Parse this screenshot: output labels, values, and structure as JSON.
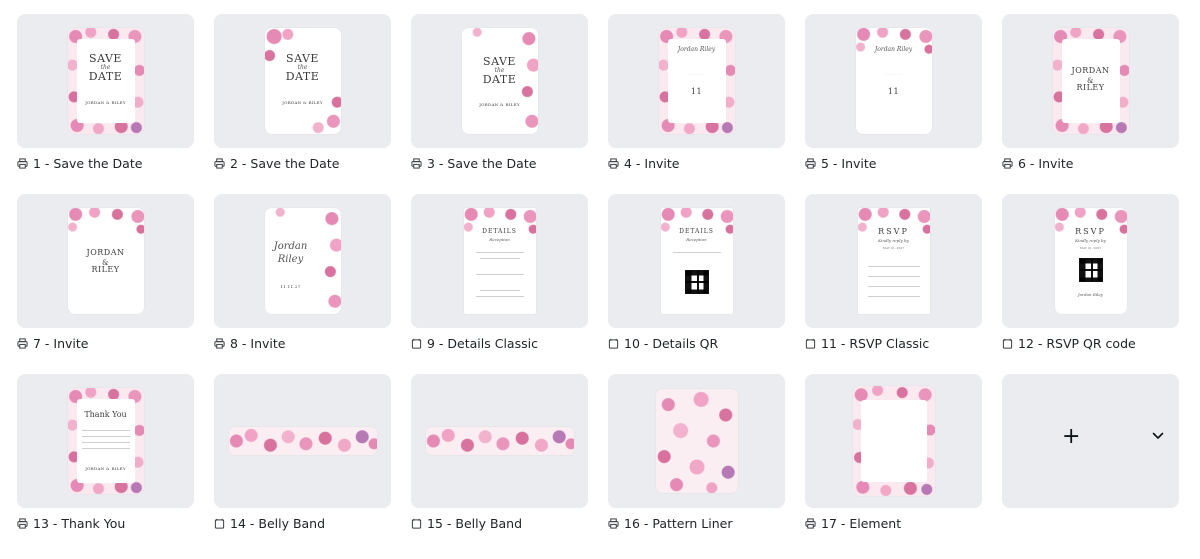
{
  "templates": [
    {
      "label": "1 - Save the Date",
      "type": "print"
    },
    {
      "label": "2 - Save the Date",
      "type": "print"
    },
    {
      "label": "3 - Save the Date",
      "type": "print"
    },
    {
      "label": "4 - Invite",
      "type": "print"
    },
    {
      "label": "5 - Invite",
      "type": "print"
    },
    {
      "label": "6 - Invite",
      "type": "print"
    },
    {
      "label": "7 - Invite",
      "type": "print"
    },
    {
      "label": "8 - Invite",
      "type": "print"
    },
    {
      "label": "9 - Details Classic",
      "type": "page"
    },
    {
      "label": "10 - Details QR",
      "type": "page"
    },
    {
      "label": "11 - RSVP Classic",
      "type": "page"
    },
    {
      "label": "12 - RSVP QR code",
      "type": "page"
    },
    {
      "label": "13 - Thank You",
      "type": "print"
    },
    {
      "label": "14 - Belly Band",
      "type": "page"
    },
    {
      "label": "15 - Belly Band",
      "type": "page"
    },
    {
      "label": "16 - Pattern Liner",
      "type": "print"
    },
    {
      "label": "17 - Element",
      "type": "print"
    }
  ],
  "card_text": {
    "save": "SAVE",
    "the": "the",
    "date": "DATE",
    "names_caps": "JORDAN & RILEY",
    "jordan": "JORDAN",
    "amp": "&",
    "riley": "RILEY",
    "script_names": "Jordan Riley",
    "day": "11",
    "details": "DETAILS",
    "reception": "Reception",
    "rsvp": "RSVP",
    "kindly": "Kindly reply by",
    "rsvp_date": "MAY 01, 2027",
    "thank_you": "Thank You",
    "date_short": "11.11.27"
  },
  "add_tile": {
    "plus": "+",
    "icon": "chevron-down-icon"
  }
}
